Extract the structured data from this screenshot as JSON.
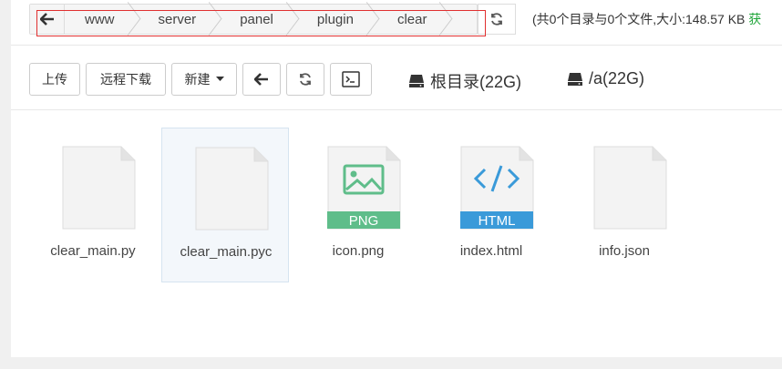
{
  "breadcrumb": {
    "items": [
      "www",
      "server",
      "panel",
      "plugin",
      "clear"
    ]
  },
  "summary": {
    "text": "(共0个目录与0个文件,大小:148.57 KB",
    "link": "获"
  },
  "toolbar": {
    "upload": "上传",
    "remote_download": "远程下载",
    "new": "新建"
  },
  "disks": [
    {
      "label": "根目录(22G)"
    },
    {
      "label": "/a(22G)"
    }
  ],
  "files": [
    {
      "name": "clear_main.py",
      "type": "generic"
    },
    {
      "name": "clear_main.pyc",
      "type": "generic",
      "selected": true
    },
    {
      "name": "icon.png",
      "type": "png",
      "badge": "PNG",
      "color": "#5fbd8a"
    },
    {
      "name": "index.html",
      "type": "html",
      "badge": "HTML",
      "color": "#3a9ad9"
    },
    {
      "name": "info.json",
      "type": "generic"
    }
  ],
  "colors": {
    "accent_green": "#20a53a",
    "selection_border": "#e03030"
  }
}
